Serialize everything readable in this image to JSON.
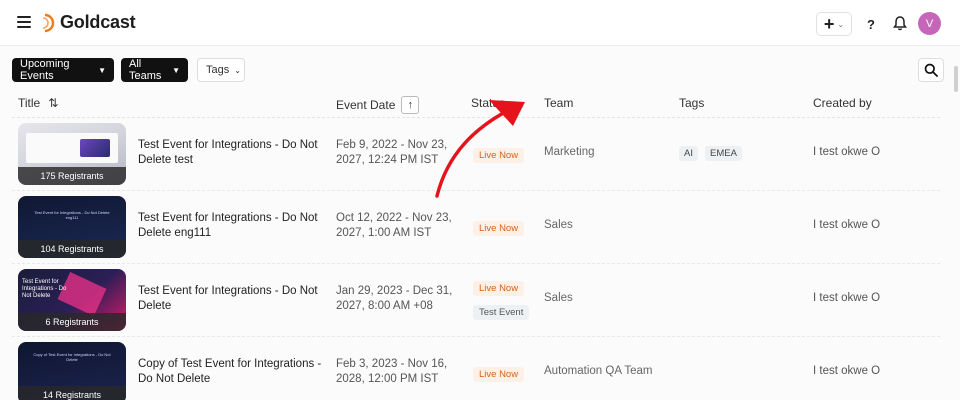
{
  "app": {
    "name": "Goldcast",
    "brand_color": "#f07a1a"
  },
  "header": {
    "add_label": "+",
    "help_label": "?",
    "avatar_initial": "V",
    "avatar_color": "#c566b8"
  },
  "filters": {
    "events": "Upcoming Events",
    "teams": "All Teams",
    "tags": "Tags"
  },
  "table": {
    "columns": {
      "title": "Title",
      "event_date": "Event Date",
      "status": "Status",
      "team": "Team",
      "tags": "Tags",
      "created_by": "Created by"
    },
    "rows": [
      {
        "title": "Test Event for Integrations - Do Not Delete test",
        "registrants": "175 Registrants",
        "date": "Feb 9, 2022 - Nov 23, 2027, 12:24 PM IST",
        "status": [
          "Live Now"
        ],
        "team": "Marketing",
        "tags": [
          "AI",
          "EMEA"
        ],
        "created_by": "I test okwe O"
      },
      {
        "title": "Test Event for Integrations - Do Not Delete eng111",
        "registrants": "104 Registrants",
        "thumb_text": "Test Event for Integrations - Do Not Delete eng111",
        "date": "Oct 12, 2022 - Nov 23, 2027, 1:00 AM IST",
        "status": [
          "Live Now"
        ],
        "team": "Sales",
        "tags": [],
        "created_by": "I test okwe O"
      },
      {
        "title": "Test Event for Integrations - Do Not Delete",
        "registrants": "6 Registrants",
        "thumb_text": "Test Event for Integrations - Do Not Delete",
        "date": "Jan 29, 2023 - Dec 31, 2027, 8:00 AM +08",
        "status": [
          "Live Now",
          "Test Event"
        ],
        "team": "Sales",
        "tags": [],
        "created_by": "I test okwe O"
      },
      {
        "title": "Copy of Test Event for Integrations - Do Not Delete",
        "registrants": "14 Registrants",
        "thumb_text": "Copy of Test Event for Integrations - Do Not Delete",
        "date": "Feb 3, 2023 - Nov 16, 2028, 12:00 PM IST",
        "status": [
          "Live Now"
        ],
        "team": "Automation QA Team",
        "tags": [],
        "created_by": "I test okwe O"
      }
    ]
  },
  "icons": [
    "menu-icon",
    "goldcast-logo-icon",
    "plus-icon",
    "chevron-down-icon",
    "help-icon",
    "bell-icon",
    "search-icon",
    "sort-icon",
    "arrow-up-icon"
  ],
  "colors": {
    "live_badge_bg": "#fdf0e6",
    "live_badge_text": "#d5621a",
    "annotation_arrow": "#e5141c"
  }
}
